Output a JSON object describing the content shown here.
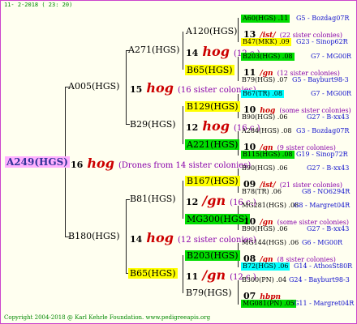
{
  "date": "11- 2-2018 ( 23: 20)",
  "root": {
    "label": "A249(HGS)",
    "num": "16",
    "hog": "hog",
    "note": "(Drones from 14 sister colonies)"
  },
  "g1": [
    {
      "label": "A005(HGS)",
      "num": "15",
      "hog": "hog",
      "note": "(16 sister colonies)"
    },
    {
      "label": "B180(HGS)",
      "num": "14",
      "hog": "hog",
      "note": "(12 sister colonies)"
    }
  ],
  "g2": [
    {
      "label": "A271(HGS)",
      "num": "14",
      "hog": "hog",
      "note": "(12 c.)"
    },
    {
      "label": "B29(HGS)",
      "num": "12",
      "hog": "hog",
      "note": "(16 c.)"
    },
    {
      "label": "B81(HGS)",
      "num": "12",
      "hog": "/gn",
      "note": "(16 c.)"
    },
    {
      "label": "B65(HGS)",
      "num": "11",
      "hog": "/gn",
      "note": "(12 c.)"
    }
  ],
  "g3": [
    {
      "label": "A120(HGS)"
    },
    {
      "label": "B65(HGS)"
    },
    {
      "label": "B129(HGS)"
    },
    {
      "label": "A221(HGS)"
    },
    {
      "label": "B167(HGS)"
    },
    {
      "label": "MG300(HGS)"
    },
    {
      "label": "B203(HGS)"
    },
    {
      "label": "B79(HGS)"
    }
  ],
  "g4": [
    {
      "label": "A60(HGS) .11",
      "sp": "G5 - Bozdag07R",
      "num": "13",
      "hog": "/ist/",
      "note": "(22 sister colonies)"
    },
    {
      "label": "B47(MKK) .09",
      "sp": "G23 - Sinop62R"
    },
    {
      "label": "B203(HGS) .08",
      "sp": "G7 - MG00R",
      "num": "11",
      "hog": "/gn",
      "note": "(12 sister colonies)"
    },
    {
      "label": "B79(HGS) .07",
      "sp": "G5 - Bayburt98-3"
    },
    {
      "label": "B67(TR) .08",
      "sp": "G7 - MG00R",
      "num": "10",
      "hog": "hog",
      "note": "(some sister colonies)"
    },
    {
      "label": "B90(HGS) .06",
      "sp": "G27 - B-xx43"
    },
    {
      "label": "A284(HGS) .08",
      "sp": "G3 - Bozdag07R",
      "num": "10",
      "hog": "/gn",
      "note": "(9 sister colonies)"
    },
    {
      "label": "B115(HGS) .08",
      "sp": "G19 - Sinop72R"
    },
    {
      "label": "B90(HGS) .06",
      "sp": "G27 - B-xx43",
      "num": "09",
      "hog": "/ist/",
      "note": "(21 sister colonies)"
    },
    {
      "label": "B78(TR) .06",
      "sp": "G8 - NO6294R"
    },
    {
      "label": "MG281(HGS) .08",
      "sp": "G8 - Margret04R",
      "num": "10",
      "hog": "/gn",
      "note": "(some sister colonies)"
    },
    {
      "label": "B90(HGS) .06",
      "sp": "G27 - B-xx43"
    },
    {
      "label": "MG144(HGS) .06",
      "sp": "G6 - MG00R",
      "num": "08",
      "hog": "/gn",
      "note": "(8 sister colonies)"
    },
    {
      "label": "B72(HGS) .06",
      "sp": "G14 - AthosSt80R"
    },
    {
      "label": "B300(PN) .04",
      "sp": "G24 - Bayburt98-3",
      "num": "07",
      "hog": "hbpn",
      "note": ""
    },
    {
      "label": "MG081(PN) .05",
      "sp": "G11 - Margret04R"
    }
  ],
  "copyright": "Copyright 2004-2018 @ Karl Kehrle Foundation.   www.pedigreeapis.org"
}
